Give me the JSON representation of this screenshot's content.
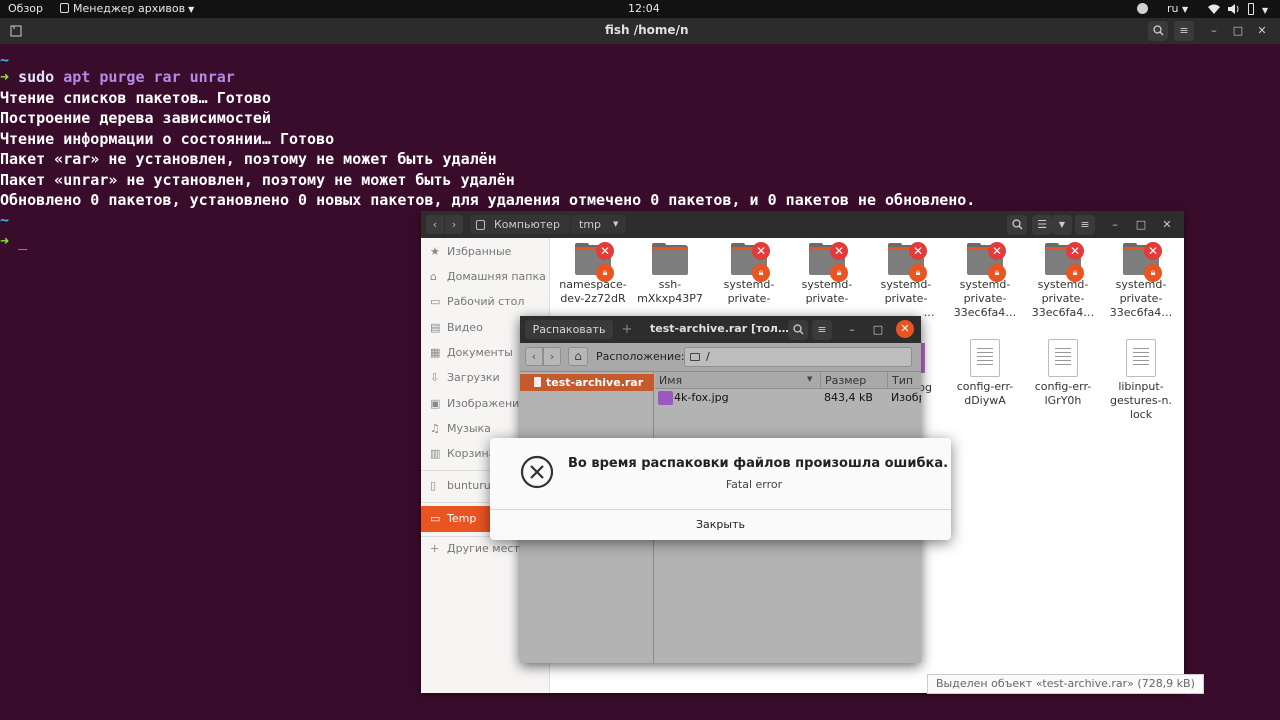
{
  "topbar": {
    "overview": "Обзор",
    "app_menu": "Менеджер архивов",
    "clock": "12:04",
    "lang": "ru"
  },
  "terminal": {
    "title": "fish /home/n",
    "lines": [
      "~",
      "sudo apt purge rar unrar",
      "Чтение списков пакетов… Готово",
      "Построение дерева зависимостей",
      "Чтение информации о состоянии… Готово",
      "Пакет «rar» не установлен, поэтому не может быть удалён",
      "Пакет «unrar» не установлен, поэтому не может быть удалён",
      "Обновлено 0 пакетов, установлено 0 новых пакетов, для удаления отмечено 0 пакетов, и 0 пакетов не обновлено.",
      "~"
    ],
    "cmd_sudo": "sudo",
    "cmd_rest": " apt purge rar unrar",
    "prompt_cursor": "_"
  },
  "files": {
    "path_computer": "Компьютер",
    "path_tmp": "tmp",
    "sidebar": [
      {
        "label": "Избранные",
        "icon": "star-icon"
      },
      {
        "label": "Домашняя папка",
        "icon": "home-icon"
      },
      {
        "label": "Рабочий стол",
        "icon": "desktop-icon"
      },
      {
        "label": "Видео",
        "icon": "video-icon"
      },
      {
        "label": "Документы",
        "icon": "documents-icon"
      },
      {
        "label": "Загрузки",
        "icon": "downloads-icon"
      },
      {
        "label": "Изображения",
        "icon": "pictures-icon"
      },
      {
        "label": "Музыка",
        "icon": "music-icon"
      },
      {
        "label": "Корзина",
        "icon": "trash-icon"
      },
      {
        "label": "bunturu",
        "icon": "drive-icon"
      },
      {
        "label": "Temp",
        "icon": "folder-icon"
      },
      {
        "label": "Другие места",
        "icon": "plus-icon"
      }
    ],
    "icons_row1": [
      {
        "l1": "namespace-",
        "l2": "dev-2z72dR",
        "l3": ""
      },
      {
        "l1": "ssh-",
        "l2": "mXkxp43P7",
        "l3": ""
      },
      {
        "l1": "systemd-",
        "l2": "private-",
        "l3": ""
      },
      {
        "l1": "systemd-",
        "l2": "private-",
        "l3": ""
      },
      {
        "l1": "systemd-",
        "l2": "private-",
        "l3": "…"
      },
      {
        "l1": "systemd-",
        "l2": "private-",
        "l3": "33ec6fa4…"
      },
      {
        "l1": "systemd-",
        "l2": "private-",
        "l3": "33ec6fa4…"
      },
      {
        "l1": "systemd-",
        "l2": "private-",
        "l3": "33ec6fa4…"
      }
    ],
    "icons_row2": [
      {
        "l1": "config-err-",
        "l2": "dDiywA",
        "l3": ""
      },
      {
        "l1": "config-err-",
        "l2": "lGrY0h",
        "l3": ""
      },
      {
        "l1": "libinput-",
        "l2": "gestures-n.",
        "l3": "lock"
      }
    ],
    "partial_jpg": "pg",
    "status": "Выделен объект «test-archive.rar» (728,9 kB)"
  },
  "roller": {
    "extract_button": "Распаковать",
    "add_button": "+",
    "title": "test-archive.rar [тол…",
    "location_label": "Расположение:",
    "location_value": "/",
    "tree_item": "test-archive.rar",
    "columns": {
      "name": "Имя",
      "size": "Размер",
      "type": "Тип"
    },
    "rows": [
      {
        "name": "4k-fox.jpg",
        "size": "843,4 kB",
        "type": "Изобр"
      }
    ]
  },
  "dialog": {
    "title": "Во время распаковки файлов произошла ошибка.",
    "message": "Fatal error",
    "close_button": "Закрыть"
  }
}
